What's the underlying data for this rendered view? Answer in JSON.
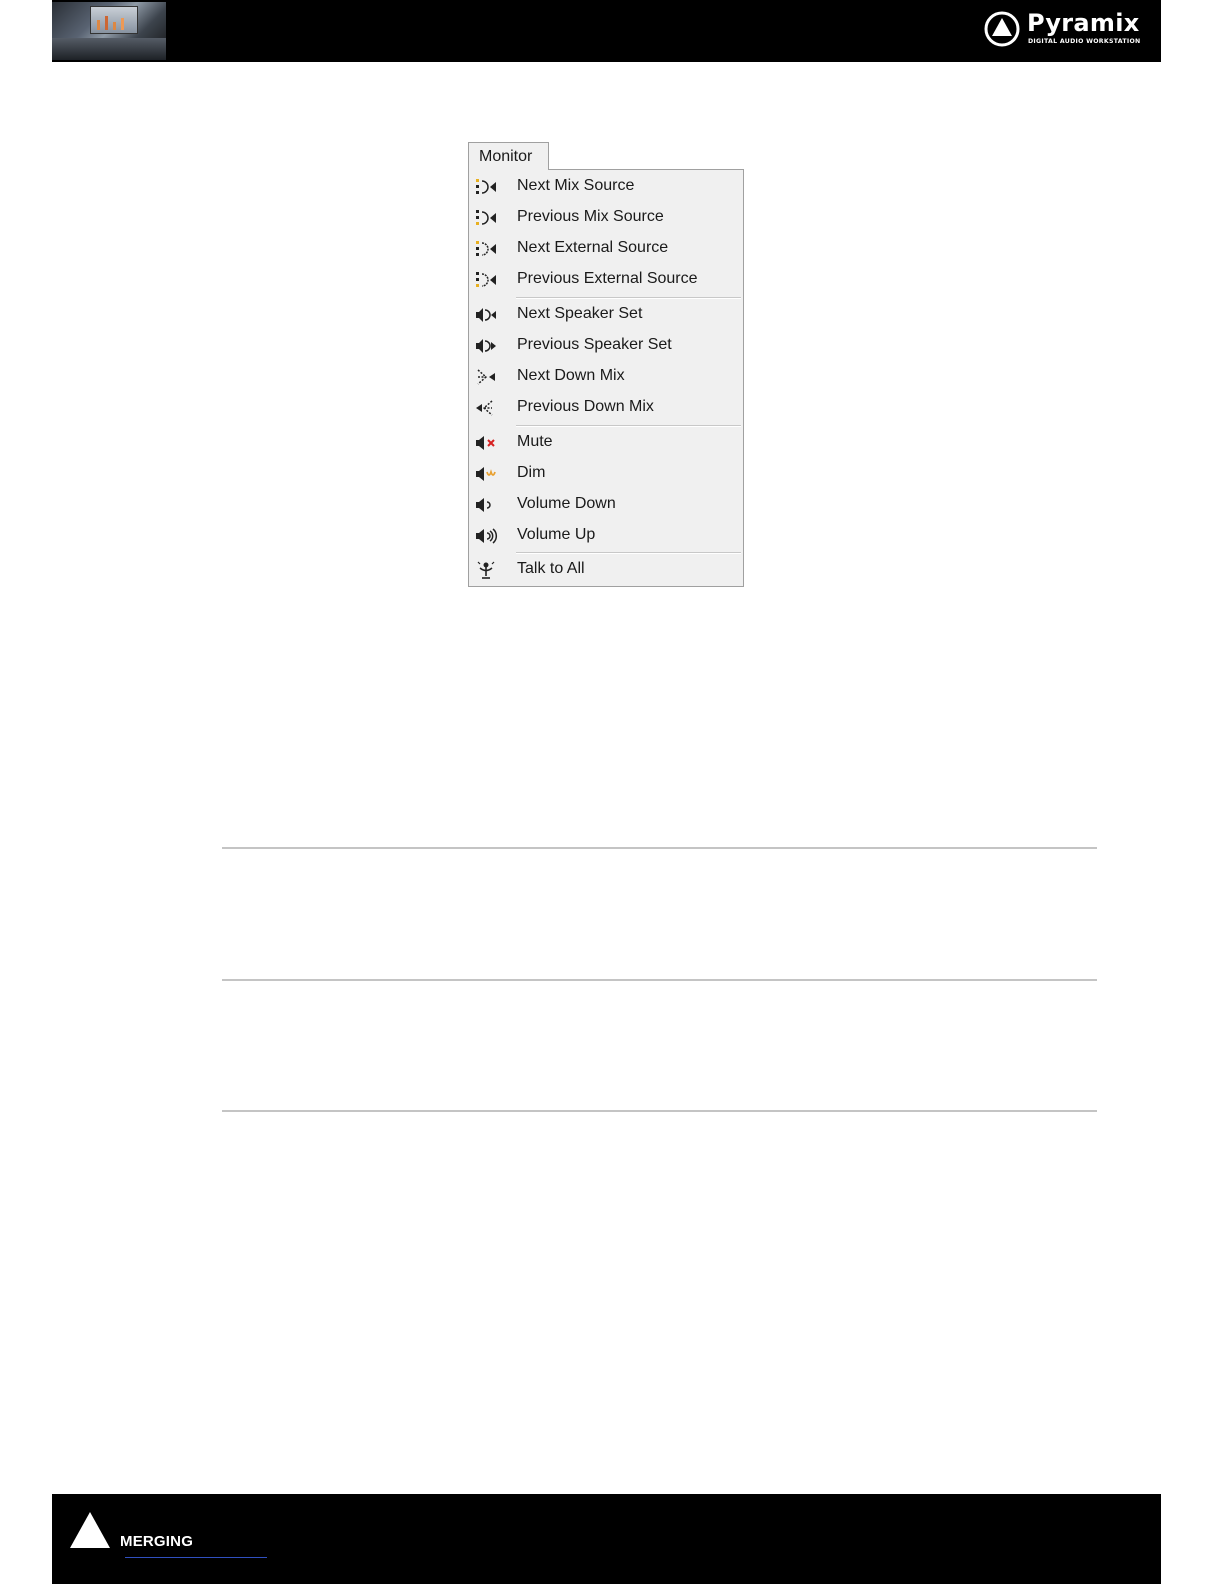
{
  "header": {
    "brand_name": "Pyramix",
    "brand_tagline": "DIGITAL AUDIO WORKSTATION"
  },
  "menu": {
    "title": "Monitor",
    "items": [
      {
        "label": "Next Mix Source",
        "icon": "mix-source-icon"
      },
      {
        "label": "Previous Mix Source",
        "icon": "mix-source-icon"
      },
      {
        "label": "Next External Source",
        "icon": "external-source-icon"
      },
      {
        "label": "Previous External Source",
        "icon": "external-source-icon"
      },
      {
        "label": "Next Speaker Set",
        "icon": "speaker-set-icon"
      },
      {
        "label": "Previous Speaker Set",
        "icon": "speaker-set-icon"
      },
      {
        "label": "Next Down Mix",
        "icon": "down-mix-icon"
      },
      {
        "label": "Previous Down Mix",
        "icon": "down-mix-icon"
      },
      {
        "label": "Mute",
        "icon": "mute-icon"
      },
      {
        "label": "Dim",
        "icon": "dim-icon"
      },
      {
        "label": "Volume Down",
        "icon": "volume-down-icon"
      },
      {
        "label": "Volume Up",
        "icon": "volume-up-icon"
      },
      {
        "label": "Talk to All",
        "icon": "talkback-icon"
      }
    ]
  },
  "footer": {
    "brand_name": "MERGING"
  },
  "colors": {
    "menu_bg": "#f0f0f0",
    "mute_accent": "#d62020",
    "dim_accent": "#e8a030",
    "source_accent": "#e8b020",
    "bar_bg": "#000000"
  }
}
